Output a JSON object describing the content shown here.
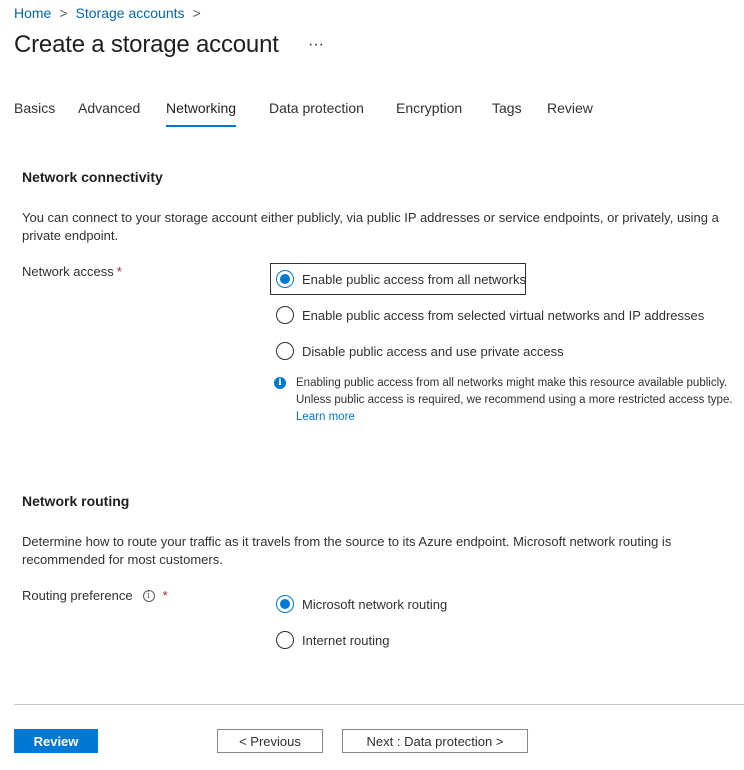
{
  "breadcrumb": {
    "home": "Home",
    "storage": "Storage accounts",
    "sep": ">"
  },
  "page": {
    "title": "Create a storage account",
    "more": "···"
  },
  "tabs": [
    {
      "label": "Basics"
    },
    {
      "label": "Advanced"
    },
    {
      "label": "Networking"
    },
    {
      "label": "Data protection"
    },
    {
      "label": "Encryption"
    },
    {
      "label": "Tags"
    },
    {
      "label": "Review"
    }
  ],
  "connectivity": {
    "heading": "Network connectivity",
    "description": "You can connect to your storage account either publicly, via public IP addresses or service endpoints, or privately, using a private endpoint.",
    "network_access_label": "Network access",
    "required_mark": "*",
    "options": [
      {
        "label": "Enable public access from all networks",
        "checked": true
      },
      {
        "label": "Enable public access from selected virtual networks and IP addresses",
        "checked": false
      },
      {
        "label": "Disable public access and use private access",
        "checked": false
      }
    ],
    "info_text": "Enabling public access from all networks might make this resource available publicly. Unless public access is required, we recommend using a more restricted access type.",
    "learn_more": "Learn more"
  },
  "routing": {
    "heading": "Network routing",
    "description": "Determine how to route your traffic as it travels from the source to its Azure endpoint. Microsoft network routing is recommended for most customers.",
    "preference_label": "Routing preference",
    "required_mark": "*",
    "options": [
      {
        "label": "Microsoft network routing",
        "checked": true
      },
      {
        "label": "Internet routing",
        "checked": false
      }
    ]
  },
  "footer": {
    "review": "Review",
    "previous": "< Previous",
    "next": "Next : Data protection >"
  }
}
